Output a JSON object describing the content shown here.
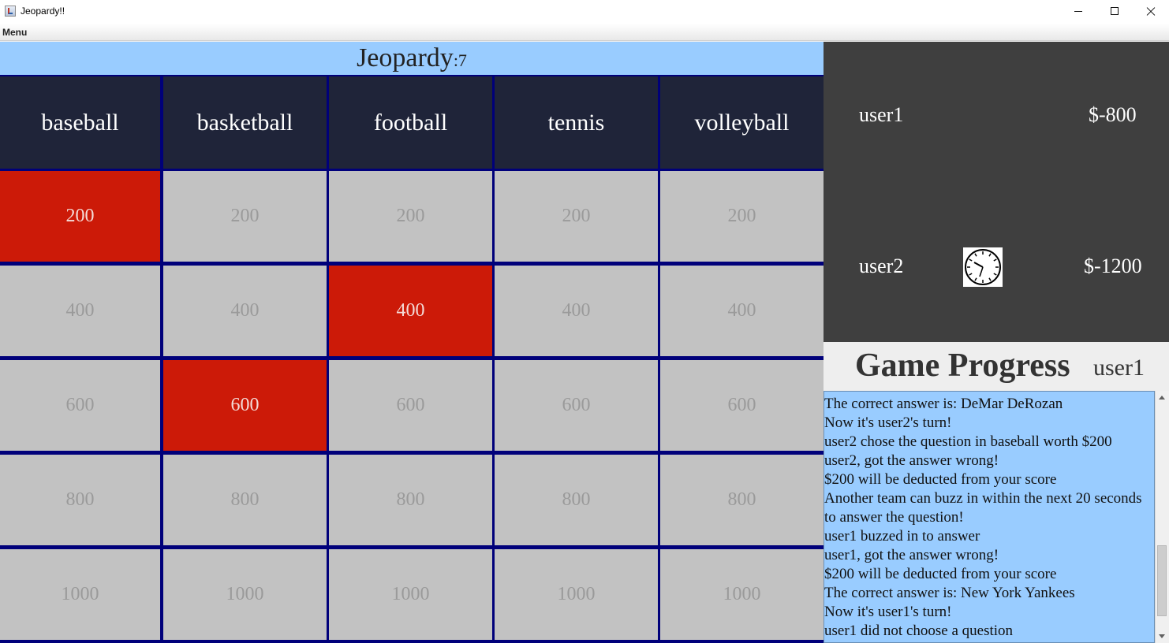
{
  "window": {
    "title": "Jeopardy!!"
  },
  "menubar": {
    "menu_label": "Menu"
  },
  "board": {
    "title": "Jeopardy",
    "count": ":7",
    "categories": [
      "baseball",
      "basketball",
      "football",
      "tennis",
      "volleyball"
    ],
    "values": [
      "200",
      "400",
      "600",
      "800",
      "1000"
    ],
    "answered": [
      [
        0,
        0
      ],
      [
        1,
        2
      ],
      [
        2,
        1
      ]
    ]
  },
  "scores": [
    {
      "name": "user1",
      "score": "$-800",
      "clock_visible": false
    },
    {
      "name": "user2",
      "score": "$-1200",
      "clock_visible": true
    }
  ],
  "progress": {
    "title": "Game Progress",
    "current_user": "user1",
    "log": [
      "The correct answer is: DeMar DeRozan",
      "Now it's user2's turn!",
      "user2 chose the question in baseball worth $200",
      "user2, got the answer wrong!",
      "$200 will be deducted from your score",
      "Another team can buzz in within the next 20 seconds",
      "to answer the question!",
      "user1 buzzed in to answer",
      "user1, got the answer wrong!",
      "$200 will be deducted from your score",
      "The correct answer is: New York Yankees",
      "Now it's user1's turn!",
      "user1 did not choose a question"
    ]
  },
  "colors": {
    "header_bar": "#99ccff",
    "category_bg": "#1f2439",
    "grid_line": "#00007a",
    "answered_cell": "#cc1a08",
    "open_cell": "#c2c2c2",
    "score_panel": "#3f3f3f",
    "log_bg": "#99ccff"
  }
}
